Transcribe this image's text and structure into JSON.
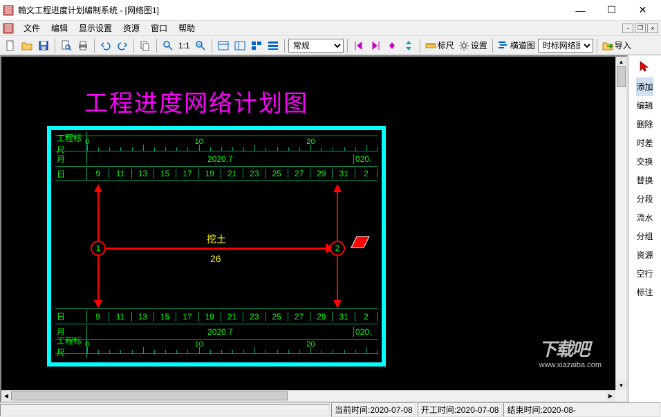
{
  "window": {
    "title": "翰文工程进度计划编制系统 - [网络图1]",
    "min": "—",
    "max": "☐",
    "close": "✕"
  },
  "menu": {
    "items": [
      "文件",
      "编辑",
      "显示设置",
      "资源",
      "窗口",
      "帮助"
    ]
  },
  "toolbar": {
    "zoom_label": "1:1",
    "dropdown1": "常规",
    "ruler_label": "标尺",
    "settings_label": "设置",
    "gantt_label": "横道图",
    "dropdown2": "时标网络图",
    "import_label": "导入"
  },
  "right_panel": {
    "items": [
      "添加",
      "编辑",
      "删除",
      "时差",
      "交换",
      "替换",
      "分段",
      "流水",
      "分组",
      "资源",
      "空行",
      "标注"
    ]
  },
  "diagram": {
    "title": "工程进度网络计划图",
    "row_headers": {
      "ruler": "工程标尺",
      "month": "月",
      "day": "日"
    },
    "ruler_majors": [
      "0",
      "10",
      "20"
    ],
    "month_main": "2020.7",
    "month_tail": "020.",
    "days": [
      "9",
      "11",
      "13",
      "15",
      "17",
      "19",
      "21",
      "23",
      "25",
      "27",
      "29",
      "31",
      "2"
    ],
    "node1": "1",
    "node2": "2",
    "task_name": "挖土",
    "task_duration": "26"
  },
  "status": {
    "blank_width": 477,
    "pane1": "当前时间:2020-07-08",
    "pane2": "开工时间:2020-07-08",
    "pane3": "结束时间:2020-08-"
  },
  "watermark": {
    "logo": "下载吧",
    "url": "www.xiazaiba.com"
  }
}
